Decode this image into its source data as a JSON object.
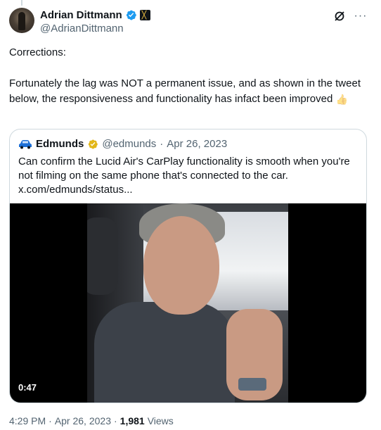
{
  "author": {
    "name": "Adrian Dittmann",
    "handle": "@AdrianDittmann",
    "verified": true,
    "affiliate_badge": "x-logo-badge"
  },
  "tweet": {
    "line1": "Corrections:",
    "line2": "Fortunately the lag was NOT a permanent issue, and as shown in the tweet below, the responsiveness and functionality has infact been improved",
    "emoji": "👍"
  },
  "quote": {
    "name": "Edmunds",
    "handle": "@edmunds",
    "separator": "·",
    "date": "Apr 26, 2023",
    "text": "Can confirm the Lucid Air's CarPlay functionality is smooth when you're not filming on the same phone that's connected to the car.",
    "link": "x.com/edmunds/status...",
    "video_duration": "0:47"
  },
  "meta": {
    "time": "4:29 PM",
    "sep": "·",
    "date": "Apr 26, 2023",
    "sep2": "·",
    "views_count": "1,981",
    "views_label": "Views"
  },
  "colors": {
    "accent": "#1d9bf0",
    "gold": "#e2b719",
    "secondary_text": "#536471",
    "border": "#cfd9de"
  }
}
